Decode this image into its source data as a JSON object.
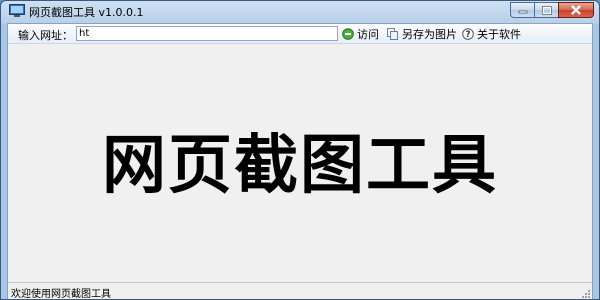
{
  "window": {
    "title": "网页截图工具 v1.0.0.1"
  },
  "toolbar": {
    "url_label": "输入网址：",
    "url_value": "ht",
    "visit_label": "访问",
    "save_label": "另存为图片",
    "about_label": "关于软件"
  },
  "main": {
    "headline": "网页截图工具"
  },
  "status": {
    "text": "欢迎使用网页截图工具"
  }
}
